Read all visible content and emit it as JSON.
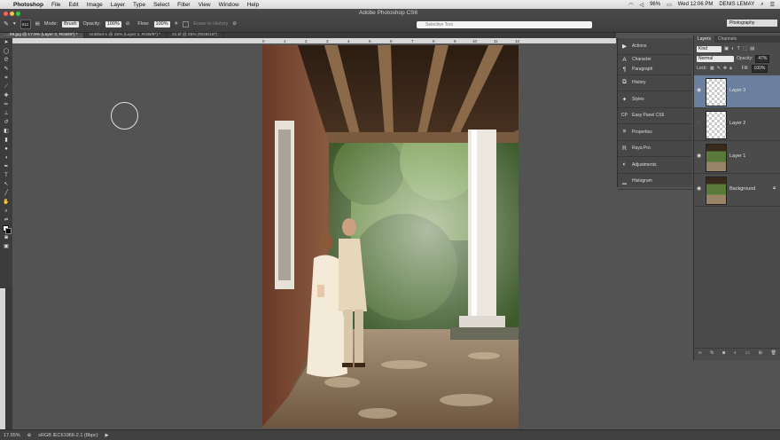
{
  "menubar": {
    "apple": "",
    "items": [
      "Photoshop",
      "File",
      "Edit",
      "Image",
      "Layer",
      "Type",
      "Select",
      "Filter",
      "View",
      "Window",
      "Help"
    ],
    "battery": "96%",
    "clock": "Wed 12:06 PM",
    "user": "DENIS LEMAY"
  },
  "app": {
    "title": "Adobe Photoshop CS6"
  },
  "options": {
    "brush_size": "611",
    "mode_label": "Mode:",
    "mode_value": "Brush",
    "opacity_label": "Opacity:",
    "opacity_value": "100%",
    "flow_label": "Flow:",
    "flow_value": "100%",
    "erase_history": "Erase to History",
    "search_placeholder": "Selective Tool",
    "workspace": "Photography"
  },
  "tabs": [
    {
      "label": "…08.jpg @ 17.9% (Layer 3, RGB/8*) *"
    },
    {
      "label": "Untitled-1 @ 25% (Layer 1, RGB/8*) *"
    },
    {
      "label": "21.tif @ 25% (RGB/16*)"
    }
  ],
  "ruler": {
    "ticks": [
      "0",
      "1",
      "2",
      "3",
      "4",
      "5",
      "6",
      "7",
      "8",
      "9",
      "10",
      "11",
      "12"
    ]
  },
  "dock": [
    {
      "icon": "actions-icon",
      "glyph": "▶",
      "label": "Actions"
    },
    {
      "icon": "character-icon",
      "glyph": "A",
      "label": "Character"
    },
    {
      "icon": "paragraph-icon",
      "glyph": "¶",
      "label": "Paragraph"
    },
    {
      "icon": "history-icon",
      "glyph": "⧉",
      "label": "History"
    },
    {
      "icon": "styles-icon",
      "glyph": "✦",
      "label": "Styles"
    },
    {
      "icon": "easy-panel-icon",
      "glyph": "CP",
      "label": "Easy Panel CS6"
    },
    {
      "icon": "properties-icon",
      "glyph": "≡",
      "label": "Properties"
    },
    {
      "icon": "raya-pro-icon",
      "glyph": "R",
      "label": "Raya Pro"
    },
    {
      "icon": "adjustments-icon",
      "glyph": "◐",
      "label": "Adjustments"
    },
    {
      "icon": "histogram-icon",
      "glyph": "▁",
      "label": "Histogram"
    }
  ],
  "layers": {
    "tab_layers": "Layers",
    "tab_channels": "Channels",
    "kind": "Kind",
    "blend_mode": "Normal",
    "opacity_label": "Opacity:",
    "opacity_value": "47%",
    "lock_label": "Lock:",
    "fill_label": "Fill:",
    "fill_value": "100%",
    "items": [
      {
        "name": "Layer 3",
        "visible": true,
        "selected": true,
        "type": "transparent"
      },
      {
        "name": "Layer 2",
        "visible": false,
        "selected": false,
        "type": "transparent"
      },
      {
        "name": "Layer 1",
        "visible": true,
        "selected": false,
        "type": "photo"
      },
      {
        "name": "Background",
        "visible": true,
        "selected": false,
        "type": "photo",
        "locked": true
      }
    ]
  },
  "status": {
    "zoom": "17.95%",
    "profile": "sRGB IEC61966-2.1 (8bpc)"
  }
}
